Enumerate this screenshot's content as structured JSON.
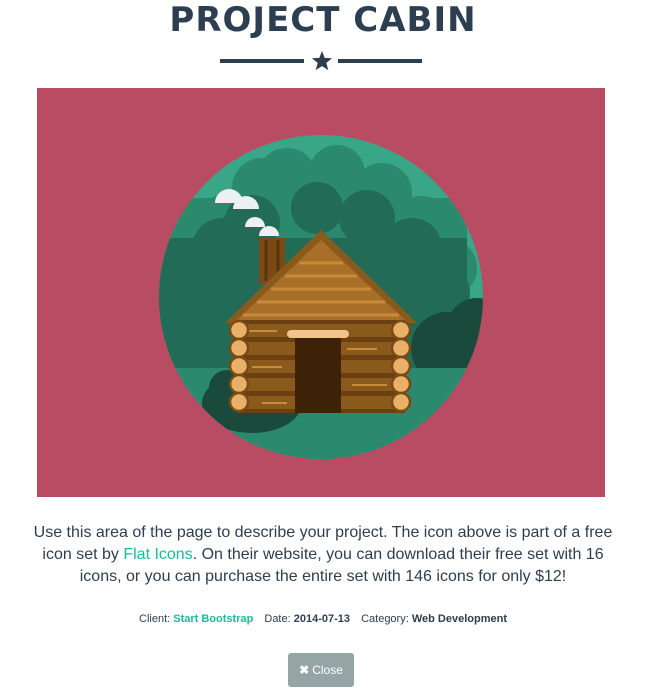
{
  "modal": {
    "title": "PROJECT CABIN",
    "image_alt": "cabin-illustration",
    "description_before": "Use this area of the page to describe your project. The icon above is part of a free icon set by ",
    "description_link": "Flat Icons",
    "description_after": ". On their website, you can download their free set with 16 icons, or you can purchase the entire set with 146 icons for only $12!",
    "meta": {
      "client_label": "Client:",
      "client_value": "Start Bootstrap",
      "date_label": "Date:",
      "date_value": "2014-07-13",
      "category_label": "Category:",
      "category_value": "Web Development"
    },
    "close_icon": "times-icon",
    "close_label": "Close"
  },
  "colors": {
    "text": "#2c3e50",
    "accent": "#18bc9c",
    "panel": "#b84c63",
    "button": "#95a5a6"
  }
}
